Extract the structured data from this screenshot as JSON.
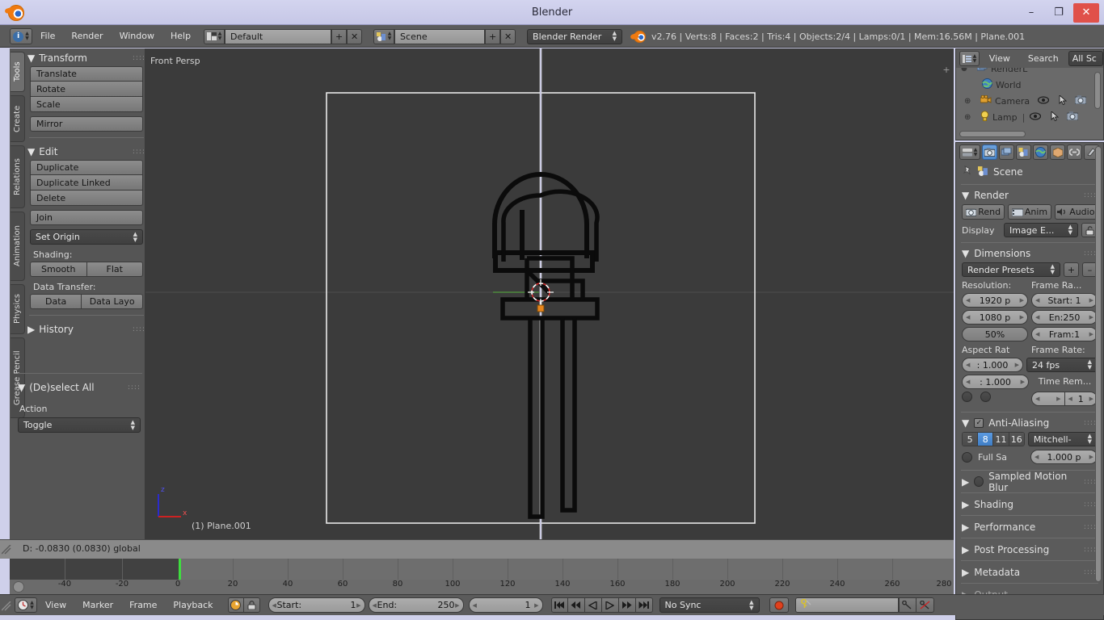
{
  "window": {
    "title": "Blender",
    "logo_icon": "blender-logo-icon",
    "minimize_label": "–",
    "maximize_label": "❐",
    "close_label": "✕"
  },
  "main_header": {
    "editor_type_icon": "info-editor-icon",
    "menus": [
      "File",
      "Render",
      "Window",
      "Help"
    ],
    "screen_layout_icon": "screen-layout-icon",
    "screen_layout_value": "Default",
    "add_layout_label": "+",
    "delete_layout_label": "✕",
    "scene_icon": "scene-icon",
    "scene_value": "Scene",
    "scene_add_label": "+",
    "scene_delete_label": "✕",
    "engine_value": "Blender Render",
    "version_stats": "v2.76 | Verts:8 | Faces:2 | Tris:4 | Objects:2/4 | Lamps:0/1 | Mem:16.56M | Plane.001"
  },
  "toolshelf": {
    "tabs": [
      {
        "label": "Tools",
        "active": true
      },
      {
        "label": "Create",
        "active": false
      },
      {
        "label": "Relations",
        "active": false
      },
      {
        "label": "Animation",
        "active": false
      },
      {
        "label": "Physics",
        "active": false
      },
      {
        "label": "Grease Pencil",
        "active": false
      }
    ],
    "panels": [
      {
        "title": "Transform",
        "open": true,
        "buttons": [
          "Translate",
          "Rotate",
          "Scale",
          "Mirror"
        ]
      },
      {
        "title": "Edit",
        "open": true,
        "buttons": [
          "Duplicate",
          "Duplicate Linked",
          "Delete",
          "Join"
        ],
        "set_origin_label": "Set Origin",
        "shading_label": "Shading:",
        "shading_buttons": [
          "Smooth",
          "Flat"
        ],
        "data_transfer_label": "Data Transfer:",
        "data_transfer_buttons": [
          "Data",
          "Data Layo"
        ]
      },
      {
        "title": "History",
        "open": false
      }
    ],
    "operator_panel": {
      "title": "(De)select All",
      "action_label": "Action",
      "action_value": "Toggle"
    }
  },
  "viewport": {
    "view_label": "Front Persp",
    "object_label": "(1) Plane.001",
    "axis_z": "z",
    "axis_x": "x",
    "cursor_icon": "3d-cursor-icon",
    "origin_icon": "object-origin-icon"
  },
  "outliner": {
    "editor_icon": "outliner-editor-icon",
    "menus": [
      "View",
      "Search"
    ],
    "display_mode": "All Sc",
    "rows": [
      {
        "icon": "renderlayers-icon",
        "label": "RenderL",
        "eye": false,
        "cursor": false,
        "camera": false
      },
      {
        "icon": "world-icon",
        "label": "World",
        "eye": false,
        "cursor": false,
        "camera": false
      },
      {
        "icon": "camera-icon",
        "label": "Camera",
        "eye": true,
        "cursor": true,
        "camera": true
      },
      {
        "icon": "lamp-icon",
        "label": "Lamp",
        "eye": true,
        "cursor": true,
        "camera": true
      }
    ]
  },
  "properties": {
    "tabs": [
      {
        "icon": "render-tab-icon",
        "active": true
      },
      {
        "icon": "render-layers-tab-icon",
        "active": false
      },
      {
        "icon": "scene-tab-icon",
        "active": false
      },
      {
        "icon": "world-tab-icon",
        "active": false
      },
      {
        "icon": "object-tab-icon",
        "active": false
      },
      {
        "icon": "constraints-tab-icon",
        "active": false
      },
      {
        "icon": "modifiers-tab-icon",
        "active": false
      }
    ],
    "breadcrumb": {
      "pin_icon": "pin-icon",
      "scene_icon": "scene-icon",
      "label": "Scene"
    },
    "render": {
      "title": "Render",
      "buttons": [
        "Rend",
        "Anim",
        "Audio"
      ],
      "display_label": "Display",
      "display_value": "Image E...",
      "lock_icon": "unlock-icon"
    },
    "dimensions": {
      "title": "Dimensions",
      "presets_value": "Render Presets",
      "add_label": "+",
      "remove_label": "–",
      "resolution_label": "Resolution:",
      "resolution_x": "1920 p",
      "resolution_y": "1080 p",
      "resolution_percent": "50%",
      "frame_range_label": "Frame Ra...",
      "frame_start": "Start: 1",
      "frame_end": "En:250",
      "frame_step": "Fram:1",
      "aspect_label": "Aspect Rat",
      "aspect_x": ": 1.000",
      "aspect_y": ": 1.000",
      "frame_rate_label": "Frame Rate:",
      "frame_rate_value": "24 fps",
      "time_remap_label": "Time Rem...",
      "time_remap_old": "",
      "time_remap_new": "1"
    },
    "anti_aliasing": {
      "title": "Anti-Aliasing",
      "enabled": true,
      "samples": [
        "5",
        "8",
        "11",
        "16"
      ],
      "active_sample": "8",
      "filter_value": "Mitchell-",
      "full_sample_label": "Full Sa",
      "full_sample_checked": false,
      "size_value": "1.000 p"
    },
    "collapsed_sections": [
      {
        "title": "Sampled Motion Blur",
        "has_checkbox": true
      },
      {
        "title": "Shading",
        "has_checkbox": false
      },
      {
        "title": "Performance",
        "has_checkbox": false
      },
      {
        "title": "Post Processing",
        "has_checkbox": false
      },
      {
        "title": "Metadata",
        "has_checkbox": false
      },
      {
        "title": "Output",
        "has_checkbox": false
      }
    ]
  },
  "status_bar": {
    "text": "D: -0.0830 (0.0830) global"
  },
  "timeline": {
    "ticks": [
      "-40",
      "-20",
      "0",
      "20",
      "40",
      "60",
      "80",
      "100",
      "120",
      "140",
      "160",
      "180",
      "200",
      "220",
      "240",
      "260",
      "280"
    ],
    "current_frame": 1,
    "playhead_color": "#3fdd3f",
    "editor_icon": "timeline-editor-icon",
    "menus": [
      "View",
      "Marker",
      "Frame",
      "Playback"
    ],
    "autokey_icon": "autokey-icon",
    "lock_icon": "lock-icon",
    "start_label": "Start:",
    "start_value": "1",
    "end_label": "End:",
    "end_value": "250",
    "current_value": "1",
    "transport": [
      "jump-start-icon",
      "prev-keyframe-icon",
      "play-reverse-icon",
      "play-icon",
      "next-keyframe-icon",
      "jump-end-icon"
    ],
    "sync_value": "No Sync",
    "record_icon": "record-icon",
    "keying_set_value": "",
    "keying_set_icon": "key-icon",
    "insert_key_icon": "insert-key-icon",
    "delete_key_icon": "delete-key-icon"
  }
}
